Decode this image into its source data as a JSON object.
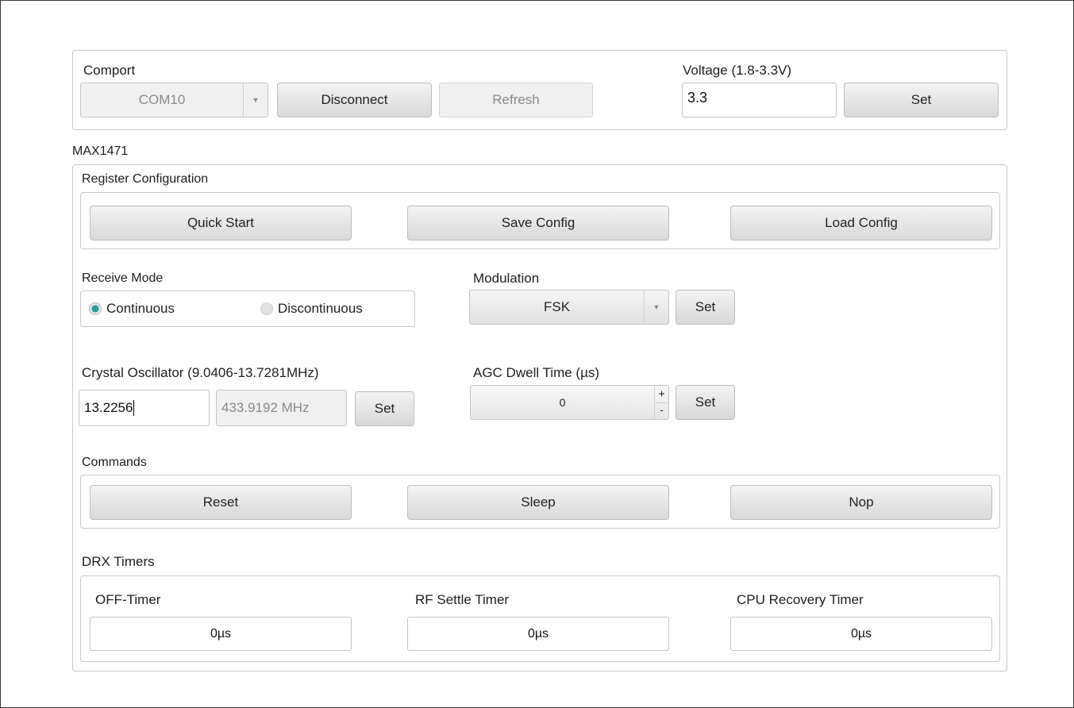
{
  "comport": {
    "group_label": "Comport",
    "port_value": "COM10",
    "disconnect_label": "Disconnect",
    "refresh_label": "Refresh"
  },
  "voltage": {
    "label": "Voltage (1.8-3.3V)",
    "value": "3.3",
    "set_label": "Set"
  },
  "device": {
    "name": "MAX1471"
  },
  "register_config": {
    "label": "Register Configuration",
    "quick_start_label": "Quick Start",
    "save_config_label": "Save Config",
    "load_config_label": "Load Config"
  },
  "receive_mode": {
    "label": "Receive Mode",
    "continuous_label": "Continuous",
    "discontinuous_label": "Discontinuous",
    "selected": "Continuous"
  },
  "modulation": {
    "label": "Modulation",
    "value": "FSK",
    "set_label": "Set"
  },
  "crystal": {
    "label": "Crystal Oscillator (9.0406-13.7281MHz)",
    "value": "13.2256",
    "rf_value": "433.9192 MHz",
    "set_label": "Set"
  },
  "agc": {
    "label": "AGC Dwell Time (µs)",
    "value": "0",
    "set_label": "Set",
    "up": "+",
    "down": "-"
  },
  "commands": {
    "label": "Commands",
    "reset_label": "Reset",
    "sleep_label": "Sleep",
    "nop_label": "Nop"
  },
  "drx": {
    "label": "DRX Timers",
    "off_timer_label": "OFF-Timer",
    "off_timer_value": "0µs",
    "rf_settle_label": "RF Settle Timer",
    "rf_settle_value": "0µs",
    "cpu_recovery_label": "CPU Recovery Timer",
    "cpu_recovery_value": "0µs"
  },
  "colors": {
    "radio_selected": "#2a9d9a"
  },
  "icons": {
    "dropdown": "chevron-down-icon"
  }
}
